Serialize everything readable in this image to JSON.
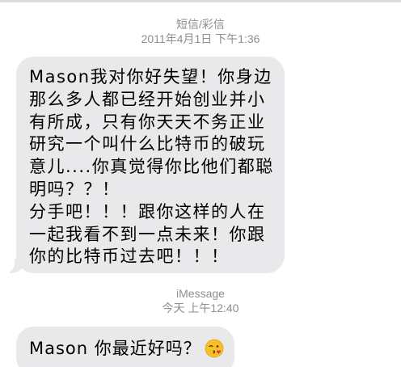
{
  "thread": {
    "header1": {
      "label": "短信/彩信",
      "date": "2011年4月1日",
      "time": "下午1:36"
    },
    "message1": {
      "lines": [
        "Mason我对你好失望！你身边",
        "那么多人都已经开始创业并小",
        "有所成，只有你天天不务正业",
        "研究一个叫什么比特币的破玩",
        "意儿....你真觉得你比他们都聪",
        "明吗？？！",
        "分手吧！！！跟你这样的人在",
        "一起我看不到一点未来！你跟",
        "你的比特币过去吧！！！"
      ]
    },
    "header2": {
      "label": "iMessage",
      "date": "今天",
      "time": "上午12:40"
    },
    "message2": {
      "text": "Mason 你最近好吗？",
      "emoji": "kissing-face-with-heart-icon"
    }
  },
  "colors": {
    "bubble": "#e9e9eb",
    "meta_text": "#8e8e93",
    "background": "#ffffff"
  }
}
